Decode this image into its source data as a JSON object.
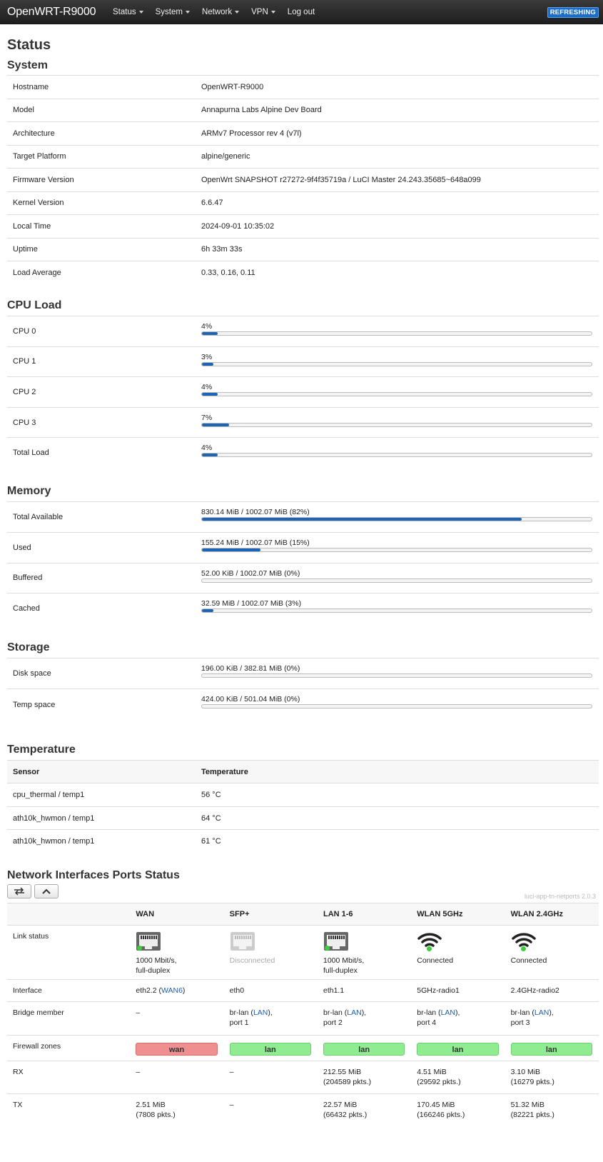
{
  "header": {
    "brand": "OpenWRT-R9000",
    "menu": [
      "Status",
      "System",
      "Network",
      "VPN",
      "Log out"
    ],
    "badge": "REFRESHING"
  },
  "page_title": "Status",
  "system": {
    "title": "System",
    "rows": [
      {
        "label": "Hostname",
        "value": "OpenWRT-R9000"
      },
      {
        "label": "Model",
        "value": "Annapurna Labs Alpine Dev Board"
      },
      {
        "label": "Architecture",
        "value": "ARMv7 Processor rev 4 (v7l)"
      },
      {
        "label": "Target Platform",
        "value": "alpine/generic"
      },
      {
        "label": "Firmware Version",
        "value": "OpenWrt SNAPSHOT r27272-9f4f35719a / LuCI Master 24.243.35685~648a099"
      },
      {
        "label": "Kernel Version",
        "value": "6.6.47"
      },
      {
        "label": "Local Time",
        "value": "2024-09-01 10:35:02"
      },
      {
        "label": "Uptime",
        "value": "6h 33m 33s"
      },
      {
        "label": "Load Average",
        "value": "0.33, 0.16, 0.11"
      }
    ]
  },
  "cpu": {
    "title": "CPU Load",
    "rows": [
      {
        "label": "CPU 0",
        "text": "4%",
        "percent": 4
      },
      {
        "label": "CPU 1",
        "text": "3%",
        "percent": 3
      },
      {
        "label": "CPU 2",
        "text": "4%",
        "percent": 4
      },
      {
        "label": "CPU 3",
        "text": "7%",
        "percent": 7
      },
      {
        "label": "Total Load",
        "text": "4%",
        "percent": 4
      }
    ]
  },
  "memory": {
    "title": "Memory",
    "rows": [
      {
        "label": "Total Available",
        "text": "830.14 MiB / 1002.07 MiB (82%)",
        "percent": 82
      },
      {
        "label": "Used",
        "text": "155.24 MiB / 1002.07 MiB (15%)",
        "percent": 15
      },
      {
        "label": "Buffered",
        "text": "52.00 KiB / 1002.07 MiB (0%)",
        "percent": 0
      },
      {
        "label": "Cached",
        "text": "32.59 MiB / 1002.07 MiB (3%)",
        "percent": 3
      }
    ]
  },
  "storage": {
    "title": "Storage",
    "rows": [
      {
        "label": "Disk space",
        "text": "196.00 KiB / 382.81 MiB (0%)",
        "percent": 0
      },
      {
        "label": "Temp space",
        "text": "424.00 KiB / 501.04 MiB (0%)",
        "percent": 0
      }
    ]
  },
  "temperature": {
    "title": "Temperature",
    "col_sensor": "Sensor",
    "col_temp": "Temperature",
    "rows": [
      {
        "sensor": "cpu_thermal / temp1",
        "temp": "56 °C"
      },
      {
        "sensor": "ath10k_hwmon / temp1",
        "temp": "64 °C"
      },
      {
        "sensor": "ath10k_hwmon / temp1",
        "temp": "61 °C"
      }
    ]
  },
  "ports": {
    "title": "Network Interfaces Ports Status",
    "version": "luci-app-tn-netports 2.0.3",
    "row_labels": {
      "link": "Link status",
      "iface": "Interface",
      "bridge": "Bridge member",
      "fw": "Firewall zones",
      "rx": "RX",
      "tx": "TX"
    },
    "columns": [
      {
        "name": "WAN",
        "icon": "ethernet-port-icon",
        "connected": true,
        "status_line1": "1000 Mbit/s,",
        "status_line2": "full-duplex",
        "iface": "eth2.2 (",
        "iface_link": "WAN6",
        "iface_end": ")",
        "bridge_a": "–",
        "bridge_link": "",
        "bridge_b": "",
        "bridge_c": "",
        "zone": "wan",
        "rx1": "–",
        "rx2": "",
        "tx1": "2.51 MiB",
        "tx2": "(7808 pkts.)"
      },
      {
        "name": "SFP+",
        "icon": "ethernet-port-icon",
        "connected": false,
        "status_line1": "Disconnected",
        "status_line2": "",
        "iface": "eth0",
        "iface_link": "",
        "iface_end": "",
        "bridge_a": "br-lan (",
        "bridge_link": "LAN",
        "bridge_b": "),",
        "bridge_c": "port 1",
        "zone": "lan",
        "rx1": "–",
        "rx2": "",
        "tx1": "–",
        "tx2": ""
      },
      {
        "name": "LAN 1-6",
        "icon": "ethernet-port-icon",
        "connected": true,
        "status_line1": "1000 Mbit/s,",
        "status_line2": "full-duplex",
        "iface": "eth1.1",
        "iface_link": "",
        "iface_end": "",
        "bridge_a": "br-lan (",
        "bridge_link": "LAN",
        "bridge_b": "),",
        "bridge_c": "port 2",
        "zone": "lan",
        "rx1": "212.55 MiB",
        "rx2": "(204589 pkts.)",
        "tx1": "22.57 MiB",
        "tx2": "(66432 pkts.)"
      },
      {
        "name": "WLAN 5GHz",
        "icon": "wifi-icon",
        "connected": true,
        "status_line1": "Connected",
        "status_line2": "",
        "iface": "5GHz-radio1",
        "iface_link": "",
        "iface_end": "",
        "bridge_a": "br-lan (",
        "bridge_link": "LAN",
        "bridge_b": "),",
        "bridge_c": "port 4",
        "zone": "lan",
        "rx1": "4.51 MiB",
        "rx2": "(29592 pkts.)",
        "tx1": "170.45 MiB",
        "tx2": "(166246 pkts.)"
      },
      {
        "name": "WLAN 2.4GHz",
        "icon": "wifi-icon",
        "connected": true,
        "status_line1": "Connected",
        "status_line2": "",
        "iface": "2.4GHz-radio2",
        "iface_link": "",
        "iface_end": "",
        "bridge_a": "br-lan (",
        "bridge_link": "LAN",
        "bridge_b": "),",
        "bridge_c": "port 3",
        "zone": "lan",
        "rx1": "3.10 MiB",
        "rx2": "(16279 pkts.)",
        "tx1": "51.32 MiB",
        "tx2": "(82221 pkts.)"
      }
    ]
  },
  "colors": {
    "bar": "#1f63b5",
    "zone_wan": "#f08f8f",
    "zone_lan": "#90ec90",
    "badge": "#1c6ec7"
  }
}
